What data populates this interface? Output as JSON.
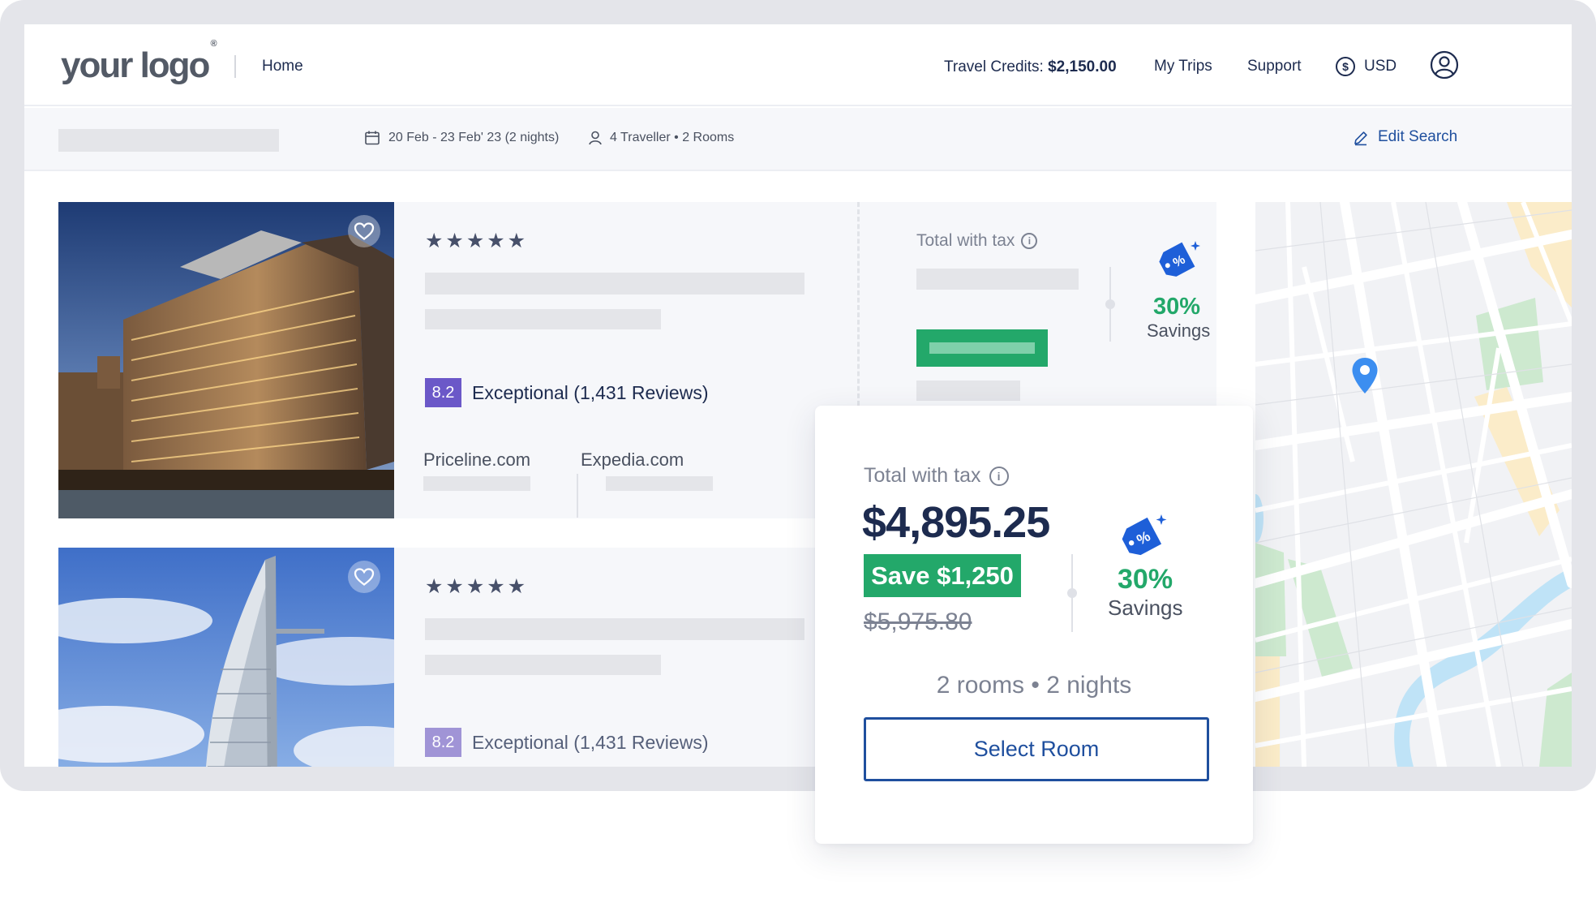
{
  "header": {
    "logo_text": "your logo",
    "logo_mark": "®",
    "nav_home": "Home",
    "credits_label": "Travel Credits:",
    "credits_value": "$2,150.00",
    "nav_trips": "My Trips",
    "nav_support": "Support",
    "currency_icon": "dollar-circle-icon",
    "currency": "USD",
    "profile_icon": "user-circle-icon"
  },
  "search": {
    "dates": "20 Feb - 23 Feb' 23 (2 nights)",
    "travellers": "4 Traveller • 2 Rooms",
    "edit_label": "Edit Search"
  },
  "results": [
    {
      "stars": "★★★★★",
      "rating": "8.2",
      "rating_text": "Exceptional (1,431 Reviews)",
      "provider_1": "Priceline.com",
      "provider_2": "Expedia.com",
      "price_label": "Total with tax",
      "savings_pct": "30%",
      "savings_label": "Savings"
    },
    {
      "stars": "★★★★★",
      "rating": "8.2",
      "rating_text": "Exceptional (1,431 Reviews)"
    }
  ],
  "price_card": {
    "label": "Total with tax",
    "price": "$4,895.25",
    "save_badge": "Save $1,250",
    "original_price": "$5,975.80",
    "savings_pct": "30%",
    "savings_label": "Savings",
    "rooms_nights": "2 rooms • 2 nights",
    "select_button": "Select Room"
  },
  "colors": {
    "primary": "#1f4f9e",
    "success": "#23a86a",
    "rating_badge": "#6b58c8",
    "text": "#1d2b4f"
  }
}
